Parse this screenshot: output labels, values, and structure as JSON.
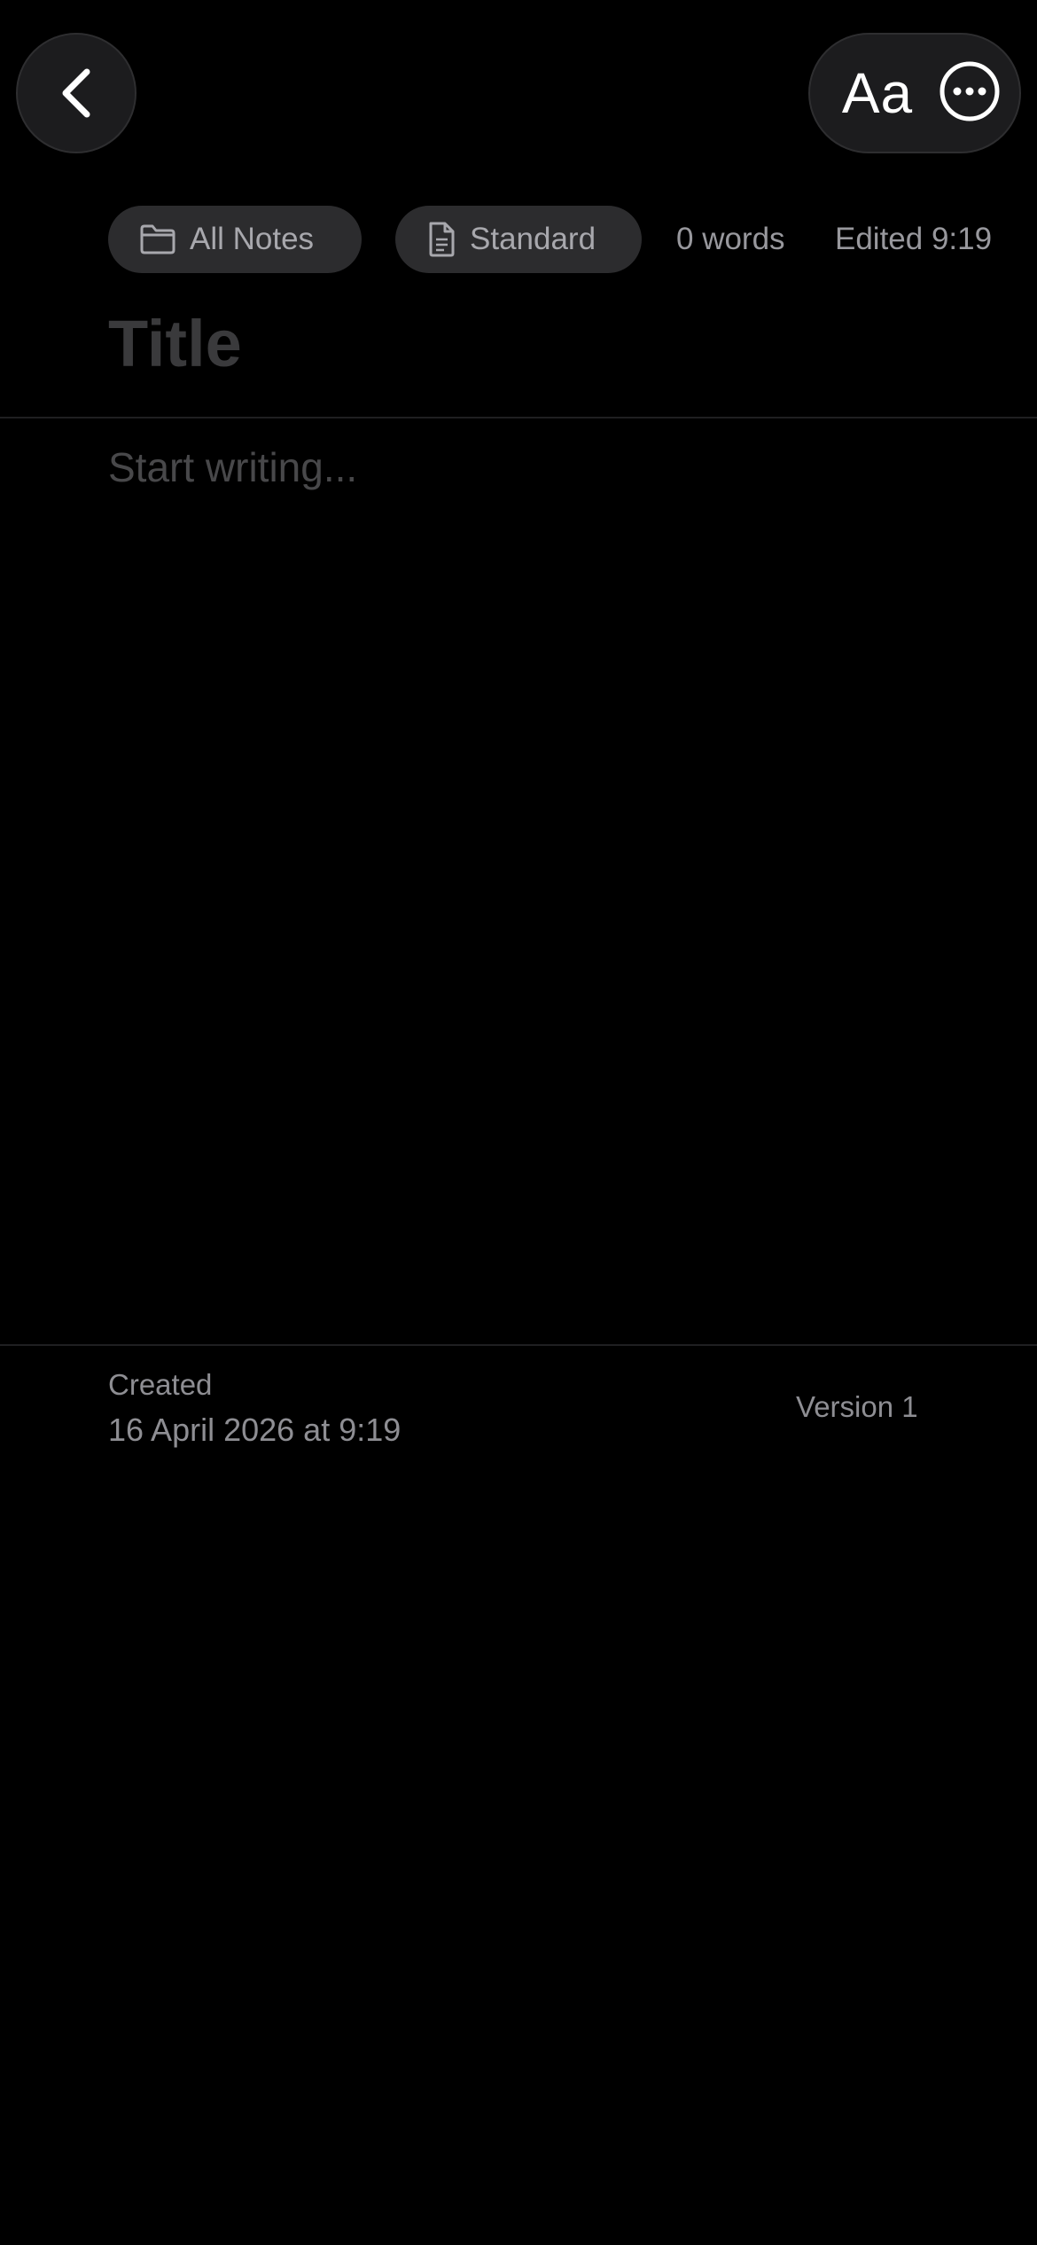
{
  "header": {
    "back_icon": "chevron-left-icon",
    "format_label": "Aa",
    "more_icon": "ellipsis-circle-icon"
  },
  "meta": {
    "folder_icon": "folder-icon",
    "folder_label": "All Notes",
    "template_icon": "document-icon",
    "template_label": "Standard",
    "word_count": "0 words",
    "edited": "Edited 9:19"
  },
  "editor": {
    "title_placeholder": "Title",
    "body_placeholder": "Start writing..."
  },
  "footer": {
    "created_label": "Created",
    "created_value": "16 April 2026 at 9:19",
    "version": "Version 1"
  },
  "colors": {
    "background": "#000000",
    "button_bg": "#1c1c1e",
    "pill_bg": "#2c2c2e",
    "placeholder": "#48484a",
    "secondary_text": "#8e8e93"
  }
}
